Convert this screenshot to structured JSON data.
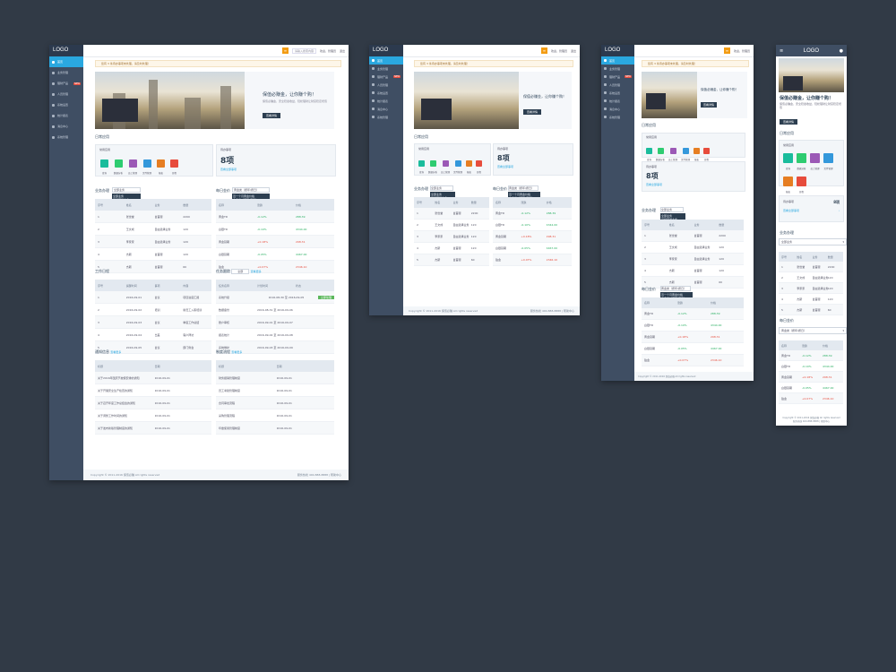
{
  "logo": "LOGO",
  "nav": [
    "首页",
    "业务管理",
    "理财产品",
    "人员管理",
    "系统设置",
    "统计报表",
    "消息中心",
    "系统管理"
  ],
  "new_badge": "NEW",
  "top": {
    "search": "请输入搜索内容",
    "user": "欢迎，管理员",
    "logout": "退出"
  },
  "notice": "您有 3 条待办事项未处理，请及时处理！",
  "banner": {
    "title": "保值必赚金，让你赚个购！",
    "desc": "保值必赚金，安全稳健收益，轻松理财让财富稳定增值",
    "button": "查看详情"
  },
  "apps": {
    "title": "日常应用",
    "subtitle": "常用应用",
    "items": [
      {
        "label": "查询",
        "color": "#1abc9c"
      },
      {
        "label": "数据分析",
        "color": "#2ecc71"
      },
      {
        "label": "员工管理",
        "color": "#9b59b6"
      },
      {
        "label": "文件管理",
        "color": "#3498db"
      },
      {
        "label": "报表",
        "color": "#e67e22"
      },
      {
        "label": "日程",
        "color": "#e74c3c"
      }
    ]
  },
  "todo": {
    "label": "待办事项",
    "count": "8项",
    "more": "查看全部事项"
  },
  "business": {
    "title": "业务办理",
    "select": "全部业务",
    "options": [
      "全部业务",
      "已经开通业务"
    ],
    "cols": [
      "序号",
      "姓名",
      "业务",
      "数量"
    ],
    "rows": [
      [
        "1",
        "张世堂",
        "金首服",
        "2200"
      ],
      [
        "2",
        "王文成",
        "自由选择业务",
        "120"
      ],
      [
        "3",
        "李家家",
        "自由选择业务",
        "120"
      ],
      [
        "4",
        "杰斯",
        "金首服",
        "120"
      ],
      [
        "5",
        "杰斯",
        "金首服",
        "60"
      ]
    ]
  },
  "fund": {
    "title": "每日金价",
    "select": "黄金类（按年/按日）",
    "options": [
      "近一个月黄金价格",
      "白金类（按年/按日）"
    ],
    "cols": [
      "名称",
      "涨跌",
      "价格"
    ],
    "rows": [
      [
        "黄金TD",
        "-0.12%",
        "288.39"
      ],
      [
        "白银TD",
        "-0.10%",
        "4344.00"
      ],
      [
        "黄金延期",
        "+0.18%",
        "298.31"
      ],
      [
        "白银延期",
        "-0.05%",
        "4467.00"
      ],
      [
        "铂金",
        "+0.07%",
        "2346.10"
      ]
    ]
  },
  "work": {
    "title": "工作日程",
    "cols": [
      "序号",
      "提醒时间",
      "事项",
      "内容"
    ],
    "rows": [
      [
        "1",
        "2016-09-01",
        "会议",
        "项目进度汇报"
      ],
      [
        "2",
        "2016-09-02",
        "培训",
        "新员工入职培训"
      ],
      [
        "3",
        "2016-09-03",
        "会议",
        "季度工作总结"
      ],
      [
        "4",
        "2016-09-04",
        "出差",
        "客户拜访"
      ],
      [
        "5",
        "2016-09-05",
        "会议",
        "部门例会"
      ]
    ]
  },
  "tasks": {
    "title": "任务跟踪",
    "select": "全部",
    "more": "查看更多",
    "cols": [
      "任务名称",
      "计划时间",
      "状态"
    ],
    "rows": [
      [
        "系统升级",
        "2016-08-30 至 2016-09-05",
        "进行中"
      ],
      [
        "数据备份",
        "2016-08-31 至 2016-09-06",
        ""
      ],
      [
        "账户审核",
        "2016-09-01 至 2016-09-07",
        ""
      ],
      [
        "报表统计",
        "2016-09-02 至 2016-09-08",
        ""
      ],
      [
        "系统维护",
        "2016-09-03 至 2016-09-09",
        ""
      ]
    ],
    "button": "立即处理"
  },
  "news": {
    "title": "通知信息",
    "more": "查看更多",
    "cols": [
      "标题",
      "日期"
    ],
    "rows": [
      [
        "关于2016年国庆节放假安排的通知",
        "2016-09-01"
      ],
      [
        "关于开展安全生产检查的通知",
        "2016-09-01"
      ],
      [
        "关于召开年度工作总结会的通知",
        "2016-09-01"
      ],
      [
        "关于调整工作时间的通知",
        "2016-09-01"
      ],
      [
        "关于发布新版管理制度的通知",
        "2016-09-01"
      ]
    ]
  },
  "rules": {
    "title": "制度流程",
    "more": "查看更多",
    "cols": [
      "标题",
      "日期"
    ],
    "rows": [
      [
        "财务报销管理制度",
        "2016-09-01"
      ],
      [
        "员工考勤管理制度",
        "2016-09-01"
      ],
      [
        "合同审批流程",
        "2016-09-01"
      ],
      [
        "采购管理流程",
        "2016-09-01"
      ],
      [
        "印章使用管理制度",
        "2016-09-01"
      ]
    ]
  },
  "footer": {
    "left": "Copyright © 2011-2016 保值必赚 All rights reserved",
    "right": "服务热线 400-888-8888 | 帮助中心"
  }
}
